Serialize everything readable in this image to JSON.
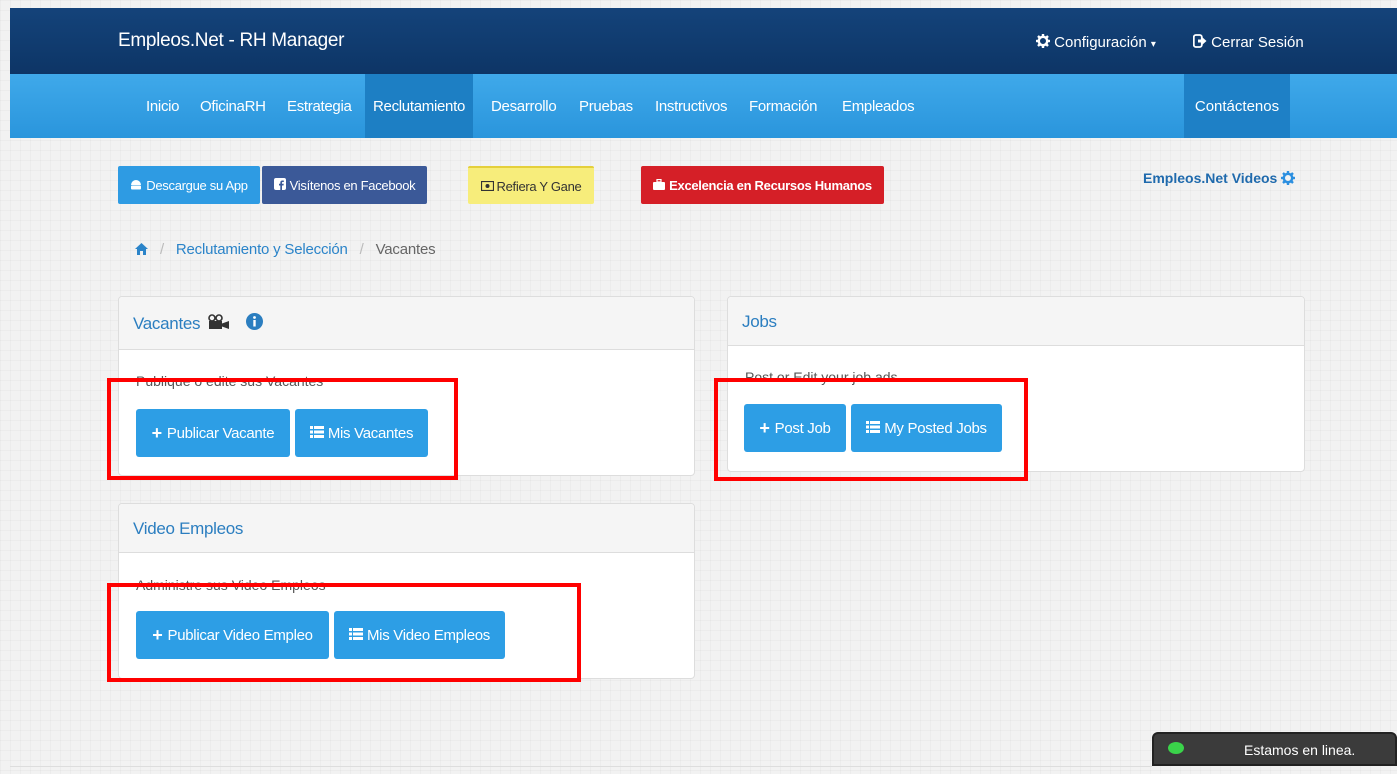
{
  "header": {
    "brand": "Empleos.Net - RH Manager",
    "config_label": "Configuración",
    "logout_label": "Cerrar Sesión"
  },
  "nav": {
    "items": [
      {
        "label": "Inicio"
      },
      {
        "label": "OficinaRH"
      },
      {
        "label": "Estrategia"
      },
      {
        "label": "Reclutamiento",
        "active": true
      },
      {
        "label": "Desarrollo"
      },
      {
        "label": "Pruebas"
      },
      {
        "label": "Instructivos"
      },
      {
        "label": "Formación"
      },
      {
        "label": "Empleados"
      }
    ],
    "contact_label": "Contáctenos"
  },
  "promo": {
    "app_label": "Descargue su App",
    "facebook_label": "Visítenos en Facebook",
    "refer_label": "Refiera Y Gane",
    "excellence_label": "Excelencia en Recursos Humanos",
    "videos_label": "Empleos.Net Videos"
  },
  "breadcrumb": {
    "items": [
      "Reclutamiento y Selección",
      "Vacantes"
    ]
  },
  "panels": {
    "vacantes": {
      "title": "Vacantes",
      "description": "Publique o edite sus Vacantes",
      "primary_label": "Publicar Vacante",
      "secondary_label": "Mis Vacantes"
    },
    "jobs": {
      "title": "Jobs",
      "description": "Post or Edit your job ads",
      "primary_label": "Post Job",
      "secondary_label": "My Posted Jobs"
    },
    "video": {
      "title": "Video Empleos",
      "description": "Administre sus Video Empleos",
      "primary_label": "Publicar Video Empleo",
      "secondary_label": "Mis Video Empleos"
    }
  },
  "chat": {
    "label": "Estamos en linea."
  },
  "colors": {
    "header_bg": "#14437a",
    "nav_bg": "#3fa9ea",
    "nav_active": "#1d7fc4",
    "button_primary": "#2d9ee5",
    "highlight_box": "#ff0000"
  }
}
